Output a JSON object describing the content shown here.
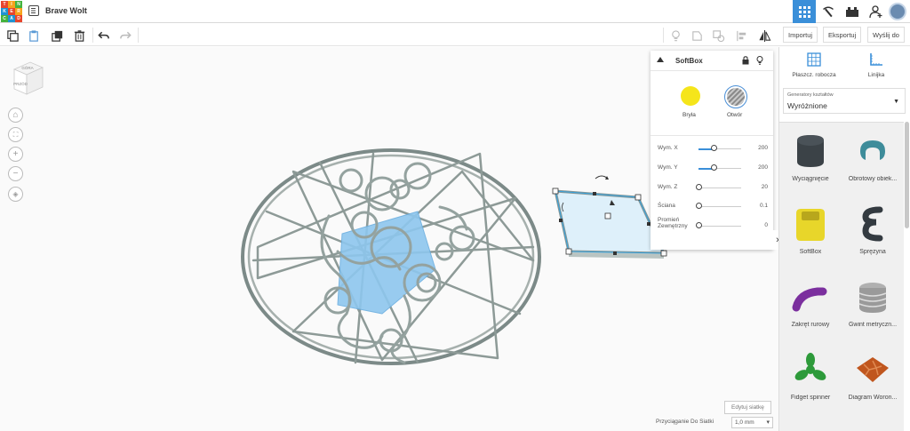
{
  "app": {
    "logo_letters": [
      "T",
      "I",
      "N",
      "K",
      "E",
      "R",
      "C",
      "A",
      "D"
    ],
    "logo_colors": [
      "#e8452c",
      "#f7a21b",
      "#45b33e",
      "#1f93d3",
      "#e8452c",
      "#f7a21b",
      "#45b33e",
      "#1f93d3",
      "#e8452c"
    ],
    "design_title": "Brave Wolt",
    "accent": "#3a8fd9"
  },
  "header": {
    "icons": [
      "grid-view-icon",
      "pickaxe-icon",
      "brick-icon",
      "add-user-icon",
      "avatar"
    ]
  },
  "toolbar": {
    "left_icons": [
      "copy-icon",
      "paste-icon",
      "duplicate-icon",
      "delete-icon",
      "undo-icon",
      "redo-icon"
    ],
    "right_icons": [
      "light-bulb-icon",
      "group-icon",
      "ungroup-icon",
      "align-icon",
      "mirror-icon"
    ],
    "import_label": "Importuj",
    "export_label": "Eksportuj",
    "send_label": "Wyślij do"
  },
  "viewcube": {
    "top_label": "GÓRA",
    "front_label": "PRZÓD"
  },
  "inspector": {
    "title": "SoftBox",
    "solid_label": "Bryła",
    "hole_label": "Otwór",
    "solid_color": "#f5e51b",
    "properties": [
      {
        "label": "Wym. X",
        "value": "200",
        "fraction": 0.35
      },
      {
        "label": "Wym. Y",
        "value": "200",
        "fraction": 0.35
      },
      {
        "label": "Wym. Z",
        "value": "20",
        "fraction": 0.0
      },
      {
        "label": "Ściana",
        "value": "0.1",
        "fraction": 0.0
      },
      {
        "label": "Promień Zewnętrzny",
        "value": "0",
        "fraction": 0.0
      }
    ]
  },
  "canvas": {
    "edit_grid_label": "Edytuj siatkę",
    "snap_label": "Przyciąganie Do Siatki",
    "snap_value": "1,0 mm"
  },
  "library": {
    "workplane_label": "Płaszcz. robocza",
    "ruler_label": "Linijka",
    "generator_caption": "Generatory kształtów",
    "generator_value": "Wyróżnione",
    "shapes": [
      {
        "name": "Wyciągnięcie",
        "color": "#3b4247"
      },
      {
        "name": "Obrotowy obiek...",
        "color": "#3e8c9a"
      },
      {
        "name": "SoftBox",
        "color": "#e8d62a"
      },
      {
        "name": "Sprężyna",
        "color": "#333a40"
      },
      {
        "name": "Zakręt rurowy",
        "color": "#7b2f9e"
      },
      {
        "name": "Gwint metryczn...",
        "color": "#9a9a9a"
      },
      {
        "name": "Fidget spinner",
        "color": "#2d9a3a"
      },
      {
        "name": "Diagram Woron...",
        "color": "#c0561e"
      }
    ]
  }
}
